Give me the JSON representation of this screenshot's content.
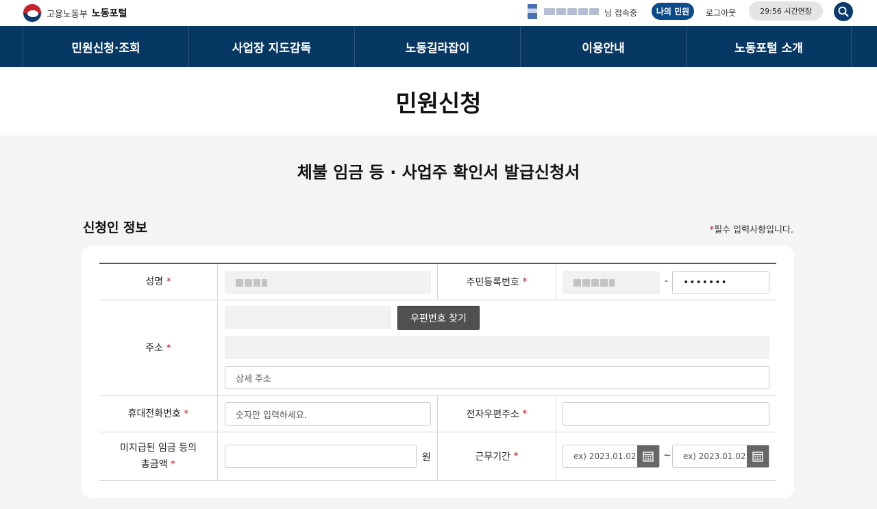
{
  "header": {
    "ministry": "고용노동부",
    "portal": "노동포털",
    "user_suffix": "님 접속중",
    "my_button": "나의 민원",
    "logout": "로그아웃",
    "timer": "29:56 시간연장",
    "search_icon": "search-icon"
  },
  "nav": {
    "items": [
      "민원신청·조회",
      "사업장 지도감독",
      "노동길라잡이",
      "이용안내",
      "노동포털 소개"
    ]
  },
  "page_title": "민원신청",
  "form_title": "체불 임금 등 · 사업주 확인서 발급신청서",
  "section": {
    "title": "신청인 정보",
    "required_note": "필수 입력사항입니다.",
    "required_mark": "*"
  },
  "form": {
    "name_label": "성명",
    "rrn_label": "주민등록번호",
    "rrn_sep": "-",
    "rrn_back_masked": "•••••••",
    "address_label": "주소",
    "zip_button": "우편번호 찾기",
    "detail_address_placeholder": "상세 주소",
    "phone_label": "휴대전화번호",
    "phone_placeholder": "숫자만 입력하세요.",
    "email_label": "전자우편주소",
    "unpaid_label_1": "미지급된 임금 등의",
    "unpaid_label_2": "총금액",
    "unpaid_unit": "원",
    "period_label": "근무기간",
    "date_placeholder": "ex) 2023.01.02",
    "period_sep": "~"
  },
  "colors": {
    "nav_bg": "#073763",
    "primary": "#0b4a8b",
    "required": "#c4141c"
  }
}
